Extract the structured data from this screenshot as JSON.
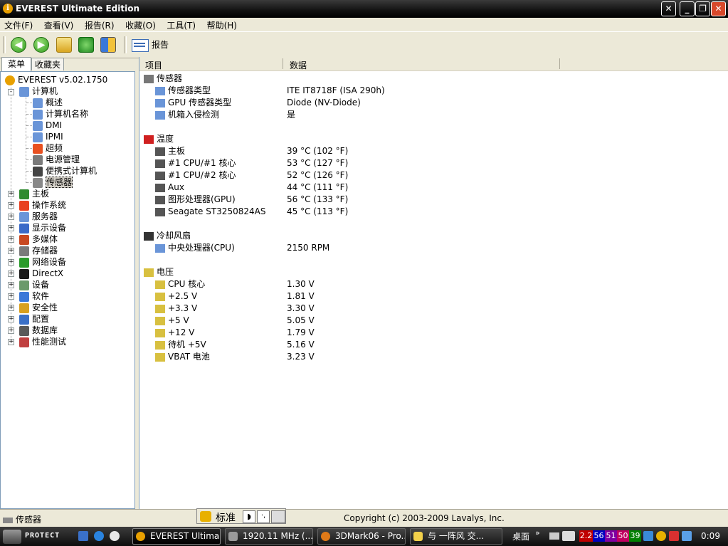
{
  "window": {
    "title": "EVEREST Ultimate Edition",
    "btn_min": "_",
    "btn_max": "❐",
    "btn_close": "✕",
    "btn_extra": "✕"
  },
  "menu": [
    "文件(F)",
    "查看(V)",
    "报告(R)",
    "收藏(O)",
    "工具(T)",
    "帮助(H)"
  ],
  "toolbar": {
    "back": "◀",
    "forward": "▶",
    "report_label": "报告"
  },
  "tabs": {
    "menu": "菜单",
    "favorites": "收藏夹"
  },
  "tree": {
    "root": "EVEREST v5.02.1750",
    "computer": "计算机",
    "computer_children": [
      "概述",
      "计算机名称",
      "DMI",
      "IPMI",
      "超频",
      "电源管理",
      "便携式计算机",
      "传感器"
    ],
    "top_items": [
      "主板",
      "操作系统",
      "服务器",
      "显示设备",
      "多媒体",
      "存储器",
      "网络设备",
      "DirectX",
      "设备",
      "软件",
      "安全性",
      "配置",
      "数据库",
      "性能测试"
    ]
  },
  "columns": {
    "item": "项目",
    "data": "数据"
  },
  "sections": [
    {
      "title": "传感器",
      "rows": [
        {
          "label": "传感器类型",
          "value": "ITE IT8718F  (ISA 290h)"
        },
        {
          "label": "GPU 传感器类型",
          "value": "Diode  (NV-Diode)"
        },
        {
          "label": "机箱入侵检测",
          "value": "是"
        }
      ]
    },
    {
      "title": "温度",
      "rows": [
        {
          "label": "主板",
          "value": "39 °C  (102 °F)"
        },
        {
          "label": "#1 CPU/#1 核心",
          "value": "53 °C  (127 °F)"
        },
        {
          "label": "#1 CPU/#2 核心",
          "value": "52 °C  (126 °F)"
        },
        {
          "label": "Aux",
          "value": "44 °C  (111 °F)"
        },
        {
          "label": "图形处理器(GPU)",
          "value": "56 °C  (133 °F)"
        },
        {
          "label": "Seagate ST3250824AS",
          "value": "45 °C  (113 °F)"
        }
      ]
    },
    {
      "title": "冷却风扇",
      "rows": [
        {
          "label": "中央处理器(CPU)",
          "value": "2150 RPM"
        }
      ]
    },
    {
      "title": "电压",
      "rows": [
        {
          "label": "CPU 核心",
          "value": "1.30 V"
        },
        {
          "label": "+2.5 V",
          "value": "1.81 V"
        },
        {
          "label": "+3.3 V",
          "value": "3.30 V"
        },
        {
          "label": "+5 V",
          "value": "5.05 V"
        },
        {
          "label": "+12 V",
          "value": "1.79 V"
        },
        {
          "label": "待机 +5V",
          "value": "5.16 V"
        },
        {
          "label": "VBAT 电池",
          "value": "3.23 V"
        }
      ]
    }
  ],
  "status": {
    "left": "传感器",
    "right": "Copyright (c) 2003-2009 Lavalys, Inc."
  },
  "ime": {
    "mode": "标准"
  },
  "taskbar": {
    "start": "PROTECT",
    "tasks": [
      "EVEREST Ultima...",
      "1920.11 MHz (...",
      "3DMark06 - Pro...",
      "与 一阵风 交..."
    ],
    "desktop": "桌面",
    "tray_numbers": [
      "2.2",
      "56",
      "51",
      "50",
      "39"
    ],
    "clock": "0:09"
  },
  "colors": {
    "accent": "#316ac5",
    "close": "#d8482b",
    "tray": [
      "#c00000",
      "#0000c0",
      "#8000a0",
      "#c00060",
      "#008000"
    ]
  }
}
